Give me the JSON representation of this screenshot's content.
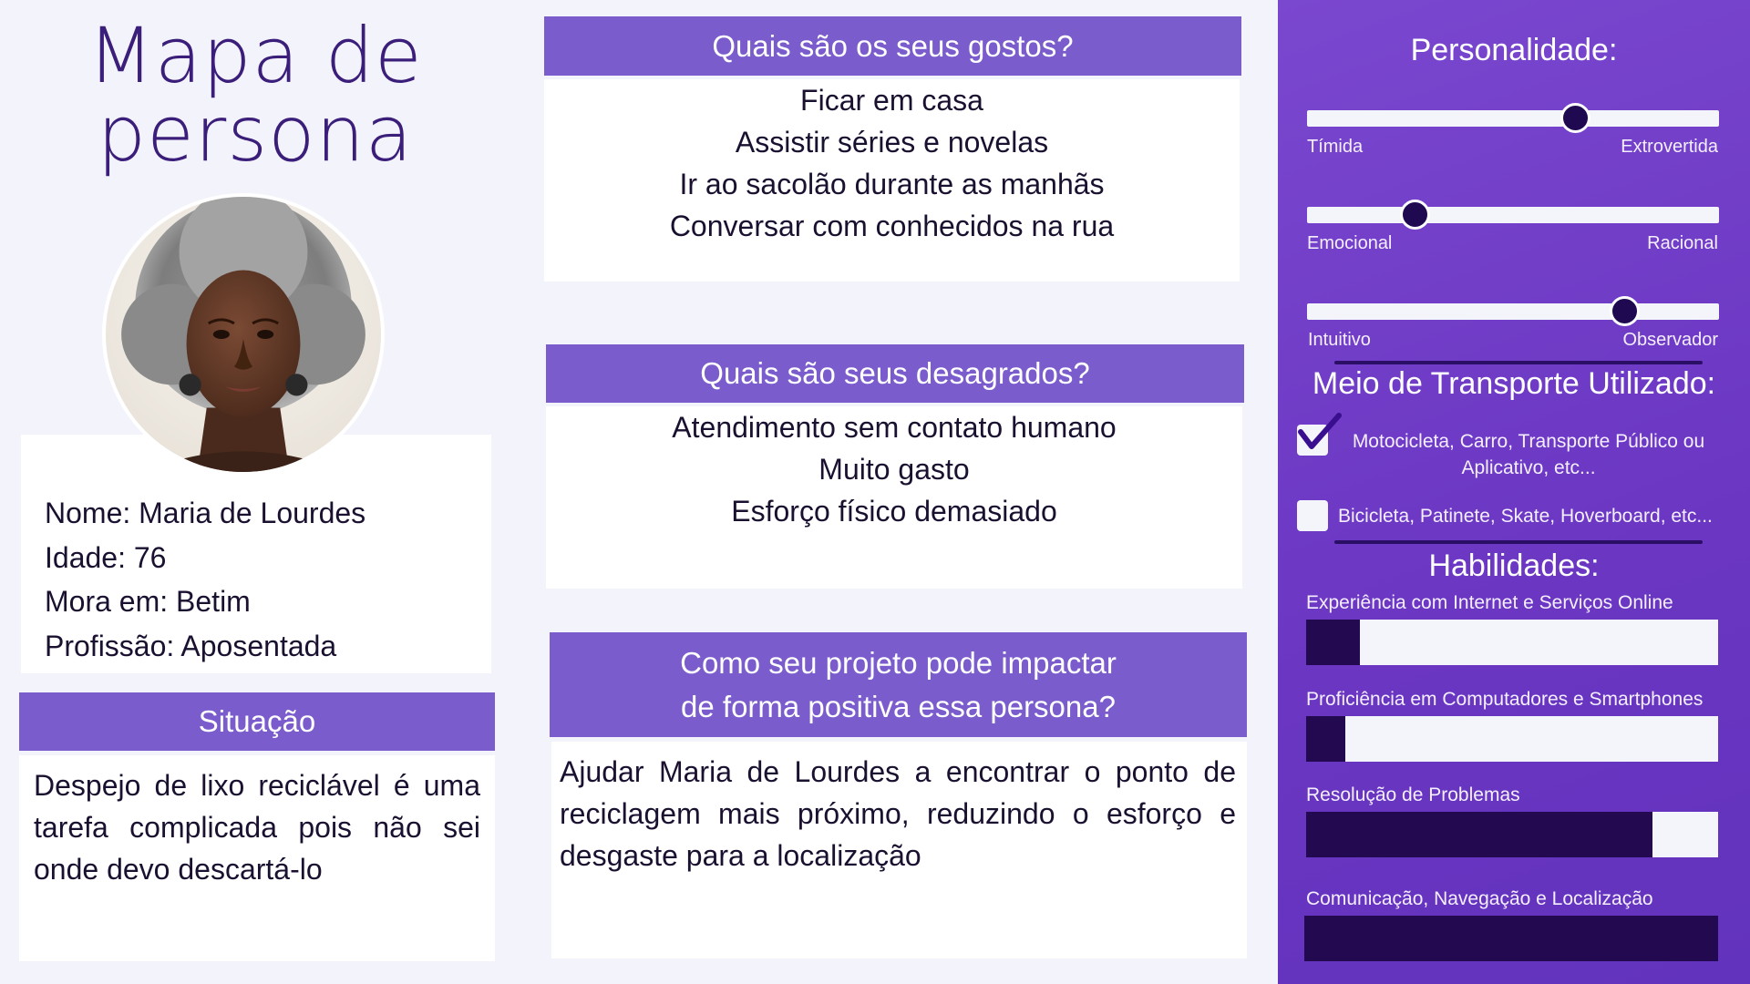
{
  "title": {
    "line1": "Mapa de",
    "line2": "persona"
  },
  "profile": {
    "name": "Nome: Maria de Lourdes",
    "age": "Idade: 76",
    "city": "Mora em: Betim",
    "job": "Profissão: Aposentada"
  },
  "situacao": {
    "header": "Situação",
    "text": "Despejo de lixo reciclável é uma tarefa complicada pois não sei onde devo descartá-lo"
  },
  "gostos": {
    "header": "Quais são os seus gostos?",
    "items": [
      "Ficar em casa",
      "Assistir séries e novelas",
      "Ir ao sacolão durante as manhãs",
      "Conversar com conhecidos na rua"
    ]
  },
  "desagrados": {
    "header": "Quais são seus desagrados?",
    "items": [
      "Atendimento sem contato humano",
      "Muito gasto",
      "Esforço físico demasiado"
    ]
  },
  "impacto": {
    "header_line1": "Como seu projeto pode impactar",
    "header_line2": "de forma positiva essa persona?",
    "text": "Ajudar Maria de Lourdes a encontrar o ponto de reciclagem mais próximo, reduzindo o esforço e desgaste para a localização"
  },
  "personalidade": {
    "title": "Personalidade:",
    "sliders": [
      {
        "left": "Tímida",
        "right": "Extrovertida",
        "value": 0.65
      },
      {
        "left": "Emocional",
        "right": "Racional",
        "value": 0.26
      },
      {
        "left": "Intuitivo",
        "right": "Observador",
        "value": 0.77
      }
    ]
  },
  "transporte": {
    "title": "Meio de Transporte Utilizado:",
    "options": [
      {
        "label_line1": "Motocicleta, Carro, Transporte Público ou",
        "label_line2": "Aplicativo, etc...",
        "checked": true
      },
      {
        "label_line1": "Bicicleta, Patinete, Skate, Hoverboard, etc...",
        "checked": false
      }
    ]
  },
  "habilidades": {
    "title": "Habilidades:",
    "skills": [
      {
        "label": "Experiência com Internet e Serviços Online",
        "value": 0.13
      },
      {
        "label": "Proficiência em Computadores e Smartphones",
        "value": 0.095
      },
      {
        "label": "Resolução de Problemas",
        "value": 0.84
      },
      {
        "label": "Comunicação, Navegação e Localização",
        "value": 1.0
      }
    ]
  },
  "colors": {
    "accent": "#7b5ccc",
    "panel": "#6a36c2",
    "dark": "#23094f",
    "background": "#f2f3fb"
  }
}
